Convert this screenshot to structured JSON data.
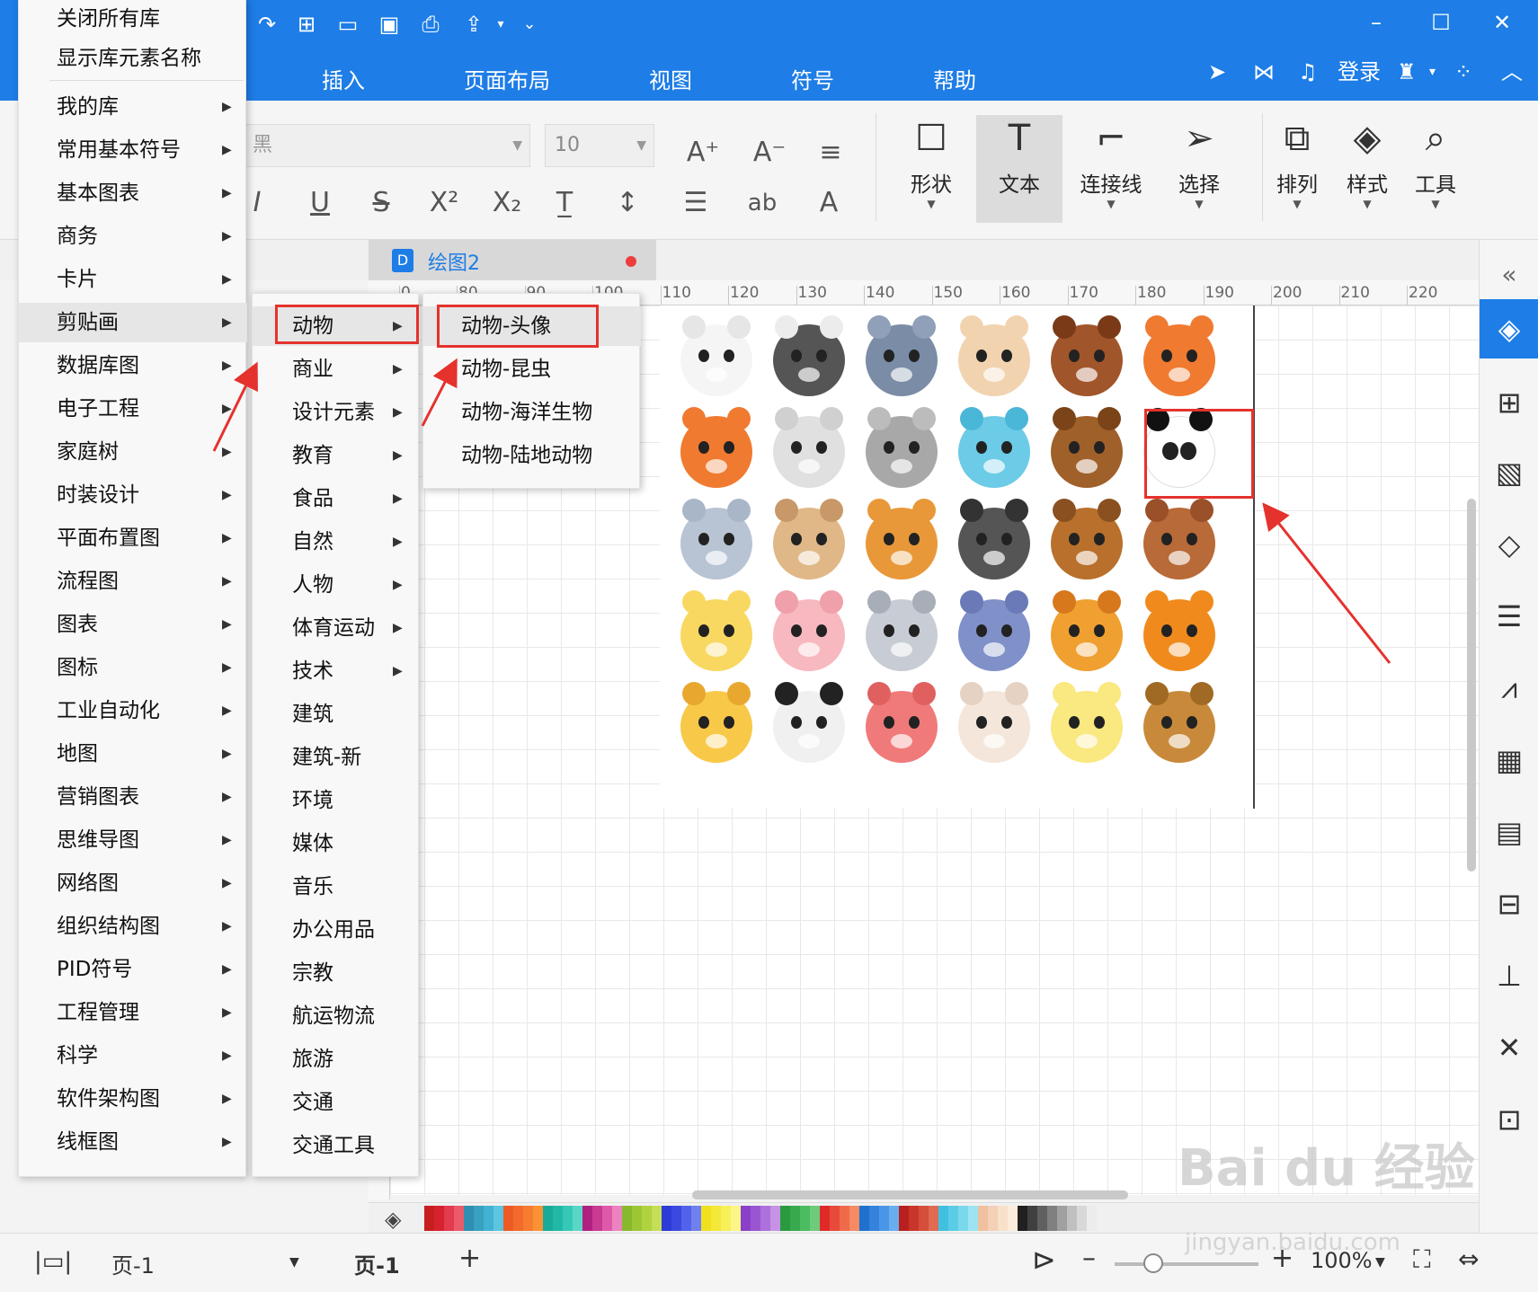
{
  "menubar": {
    "tabs": [
      "插入",
      "页面布局",
      "视图",
      "符号",
      "帮助"
    ],
    "login": "登录"
  },
  "ribbon": {
    "font_name": "黑",
    "font_size": "10",
    "tools": [
      "形状",
      "文本",
      "连接线",
      "选择",
      "排列",
      "样式",
      "工具"
    ],
    "text_ab": "ab"
  },
  "document": {
    "tab_title": "绘图2"
  },
  "ruler": {
    "ticks": [
      "0",
      "80",
      "90",
      "100",
      "110",
      "120",
      "130",
      "140",
      "150",
      "160",
      "170",
      "180",
      "190",
      "200",
      "210",
      "220"
    ]
  },
  "menu1": {
    "top_items": [
      "关闭所有库",
      "显示库元素名称"
    ],
    "items": [
      "我的库",
      "常用基本符号",
      "基本图表",
      "商务",
      "卡片",
      "剪贴画",
      "数据库图",
      "电子工程",
      "家庭树",
      "时装设计",
      "平面布置图",
      "流程图",
      "图表",
      "图标",
      "工业自动化",
      "地图",
      "营销图表",
      "思维导图",
      "网络图",
      "组织结构图",
      "PID符号",
      "工程管理",
      "科学",
      "软件架构图",
      "线框图"
    ]
  },
  "menu2": {
    "items": [
      "动物",
      "商业",
      "设计元素",
      "教育",
      "食品",
      "自然",
      "人物",
      "体育运动",
      "技术",
      "建筑",
      "建筑-新",
      "环境",
      "媒体",
      "音乐",
      "办公用品",
      "宗教",
      "航运物流",
      "旅游",
      "交通",
      "交通工具"
    ]
  },
  "menu3": {
    "items": [
      "动物-头像",
      "动物-昆虫",
      "动物-海洋生物",
      "动物-陆地动物"
    ]
  },
  "statusbar": {
    "page_select": "页-1",
    "page_tab": "页-1",
    "zoom": "100%"
  },
  "watermark": {
    "brand": "Bai du 经验",
    "url": "jingyan.baidu.com"
  },
  "colors": {
    "accent": "#1e7de6",
    "highlight": "#e5322d"
  }
}
